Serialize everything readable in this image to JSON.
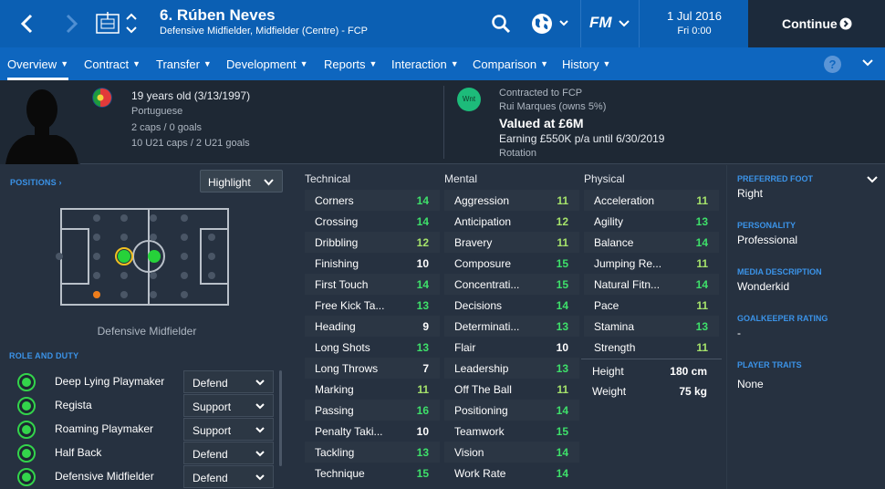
{
  "header": {
    "title": "6. Rúben Neves",
    "subtitle": "Defensive Midfielder, Midfielder (Centre) - FCP",
    "date": "1 Jul 2016",
    "day_time": "Fri 0:00",
    "continue_label": "Continue",
    "fm_label": "FM",
    "brand_color": "#0b5fb3"
  },
  "menu": [
    {
      "label": "Overview"
    },
    {
      "label": "Contract"
    },
    {
      "label": "Transfer"
    },
    {
      "label": "Development"
    },
    {
      "label": "Reports"
    },
    {
      "label": "Interaction"
    },
    {
      "label": "Comparison"
    },
    {
      "label": "History"
    }
  ],
  "help_label": "?",
  "profile": {
    "age": "19 years old (3/13/1997)",
    "nationality": "Portuguese",
    "caps": "2 caps / 0 goals",
    "u21_caps": "10 U21 caps / 2 U21 goals",
    "status_badge": "Wnt",
    "contracted": "Contracted to FCP",
    "owner": "Rui Marques (owns 5%)",
    "value": "Valued at £6M",
    "earning": "Earning £550K p/a until 6/30/2019",
    "squad_status": "Rotation"
  },
  "positions": {
    "label": "POSITIONS ›",
    "highlight": "Highlight",
    "position_name": "Defensive Midfielder"
  },
  "role_and_duty": {
    "label": "ROLE AND DUTY",
    "roles": [
      {
        "name": "Deep Lying Playmaker",
        "duty": "Defend"
      },
      {
        "name": "Regista",
        "duty": "Support"
      },
      {
        "name": "Roaming Playmaker",
        "duty": "Support"
      },
      {
        "name": "Half Back",
        "duty": "Defend"
      },
      {
        "name": "Defensive Midfielder",
        "duty": "Defend"
      }
    ]
  },
  "attributes": {
    "technical_label": "Technical",
    "mental_label": "Mental",
    "physical_label": "Physical",
    "technical": [
      {
        "name": "Corners",
        "value": "14"
      },
      {
        "name": "Crossing",
        "value": "14"
      },
      {
        "name": "Dribbling",
        "value": "12"
      },
      {
        "name": "Finishing",
        "value": "10"
      },
      {
        "name": "First Touch",
        "value": "14"
      },
      {
        "name": "Free Kick Ta...",
        "value": "13"
      },
      {
        "name": "Heading",
        "value": "9"
      },
      {
        "name": "Long Shots",
        "value": "13"
      },
      {
        "name": "Long Throws",
        "value": "7"
      },
      {
        "name": "Marking",
        "value": "11"
      },
      {
        "name": "Passing",
        "value": "16"
      },
      {
        "name": "Penalty Taki...",
        "value": "10"
      },
      {
        "name": "Tackling",
        "value": "13"
      },
      {
        "name": "Technique",
        "value": "15"
      }
    ],
    "mental": [
      {
        "name": "Aggression",
        "value": "11"
      },
      {
        "name": "Anticipation",
        "value": "12"
      },
      {
        "name": "Bravery",
        "value": "11"
      },
      {
        "name": "Composure",
        "value": "15"
      },
      {
        "name": "Concentrati...",
        "value": "15"
      },
      {
        "name": "Decisions",
        "value": "14"
      },
      {
        "name": "Determinati...",
        "value": "13"
      },
      {
        "name": "Flair",
        "value": "10"
      },
      {
        "name": "Leadership",
        "value": "13"
      },
      {
        "name": "Off The Ball",
        "value": "11"
      },
      {
        "name": "Positioning",
        "value": "14"
      },
      {
        "name": "Teamwork",
        "value": "15"
      },
      {
        "name": "Vision",
        "value": "14"
      },
      {
        "name": "Work Rate",
        "value": "14"
      }
    ],
    "physical": [
      {
        "name": "Acceleration",
        "value": "11"
      },
      {
        "name": "Agility",
        "value": "13"
      },
      {
        "name": "Balance",
        "value": "14"
      },
      {
        "name": "Jumping Re...",
        "value": "11"
      },
      {
        "name": "Natural Fitn...",
        "value": "14"
      },
      {
        "name": "Pace",
        "value": "11"
      },
      {
        "name": "Stamina",
        "value": "13"
      },
      {
        "name": "Strength",
        "value": "11"
      }
    ],
    "height_label": "Height",
    "height": "180 cm",
    "weight_label": "Weight",
    "weight": "75 kg",
    "colors": {
      "white": "#ffffff",
      "light_green": "#a6e36b",
      "green": "#3ee06a"
    }
  },
  "details": {
    "preferred_foot_label": "PREFERRED FOOT",
    "preferred_foot": "Right",
    "personality_label": "PERSONALITY",
    "personality": "Professional",
    "media_label": "MEDIA DESCRIPTION",
    "media": "Wonderkid",
    "gk_label": "GOALKEEPER RATING",
    "gk": "-",
    "traits_label": "PLAYER TRAITS",
    "traits": "None"
  }
}
